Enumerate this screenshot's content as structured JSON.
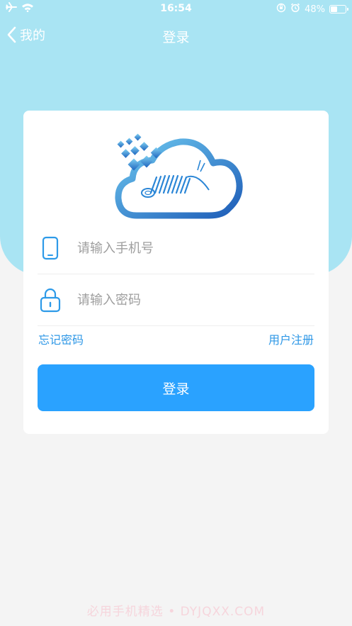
{
  "status_bar": {
    "time": "16:54",
    "battery_text": "48%",
    "battery_level": 0.48,
    "icons": [
      "airplane-icon",
      "wifi-icon",
      "orientation-lock-icon",
      "alarm-icon",
      "battery-icon"
    ]
  },
  "nav": {
    "back_label": "我的",
    "title": "登录"
  },
  "form": {
    "phone_placeholder": "请输入手机号",
    "phone_value": "",
    "password_placeholder": "请输入密码",
    "password_value": "",
    "forgot_password": "忘记密码",
    "register": "用户注册",
    "login_button": "登录"
  },
  "colors": {
    "header_bg": "#a9e4f3",
    "accent": "#2aa2ff",
    "link": "#2d97e6",
    "page_bg": "#f4f4f4"
  },
  "watermark": "必用手机精选 • DYJQXX.COM"
}
